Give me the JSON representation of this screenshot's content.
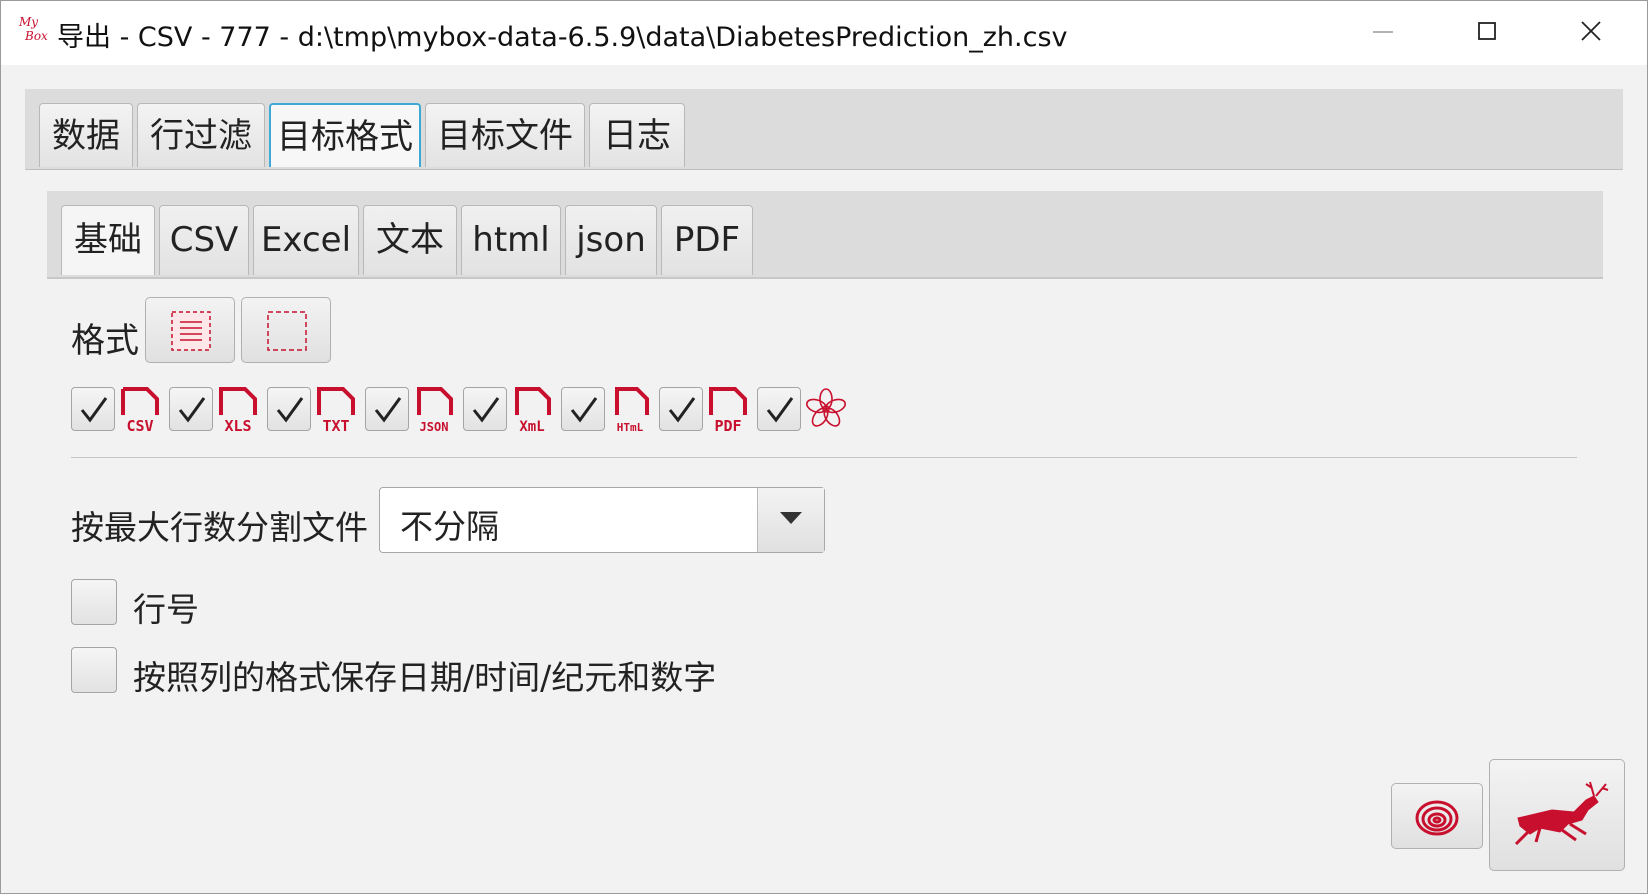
{
  "window": {
    "title": "导出 - CSV - 777 - d:\\tmp\\mybox-data-6.5.9\\data\\DiabetesPrediction_zh.csv",
    "logo_text": [
      "My",
      "Box"
    ]
  },
  "outer_tabs": [
    {
      "label": "数据",
      "active": false
    },
    {
      "label": "行过滤",
      "active": false
    },
    {
      "label": "目标格式",
      "active": true
    },
    {
      "label": "目标文件",
      "active": false
    },
    {
      "label": "日志",
      "active": false
    }
  ],
  "inner_tabs": [
    {
      "label": "基础",
      "active": true
    },
    {
      "label": "CSV",
      "active": false
    },
    {
      "label": "Excel",
      "active": false
    },
    {
      "label": "文本",
      "active": false
    },
    {
      "label": "html",
      "active": false
    },
    {
      "label": "json",
      "active": false
    },
    {
      "label": "PDF",
      "active": false
    }
  ],
  "format": {
    "label": "格式",
    "buttons": [
      "select-all-icon",
      "select-none-icon"
    ],
    "items": [
      {
        "icon": "csv-file-icon",
        "text": "CSV",
        "checked": true
      },
      {
        "icon": "xls-file-icon",
        "text": "XLS",
        "checked": true
      },
      {
        "icon": "txt-file-icon",
        "text": "TXT",
        "checked": true
      },
      {
        "icon": "json-file-icon",
        "text": "JSON",
        "checked": true
      },
      {
        "icon": "xml-file-icon",
        "text": "XmL",
        "checked": true
      },
      {
        "icon": "html-file-icon",
        "text": "HTmL",
        "checked": true
      },
      {
        "icon": "pdf-file-icon",
        "text": "PDF",
        "checked": true
      },
      {
        "icon": "flower-icon",
        "text": "",
        "checked": true
      }
    ]
  },
  "split": {
    "label": "按最大行数分割文件",
    "value": "不分隔"
  },
  "options": [
    {
      "label": "行号",
      "checked": false
    },
    {
      "label": "按照列的格式保存日期/时间/纪元和数字",
      "checked": false
    }
  ],
  "colors": {
    "accent": "#c8102e",
    "active_tab_border": "#3fa9d6"
  }
}
